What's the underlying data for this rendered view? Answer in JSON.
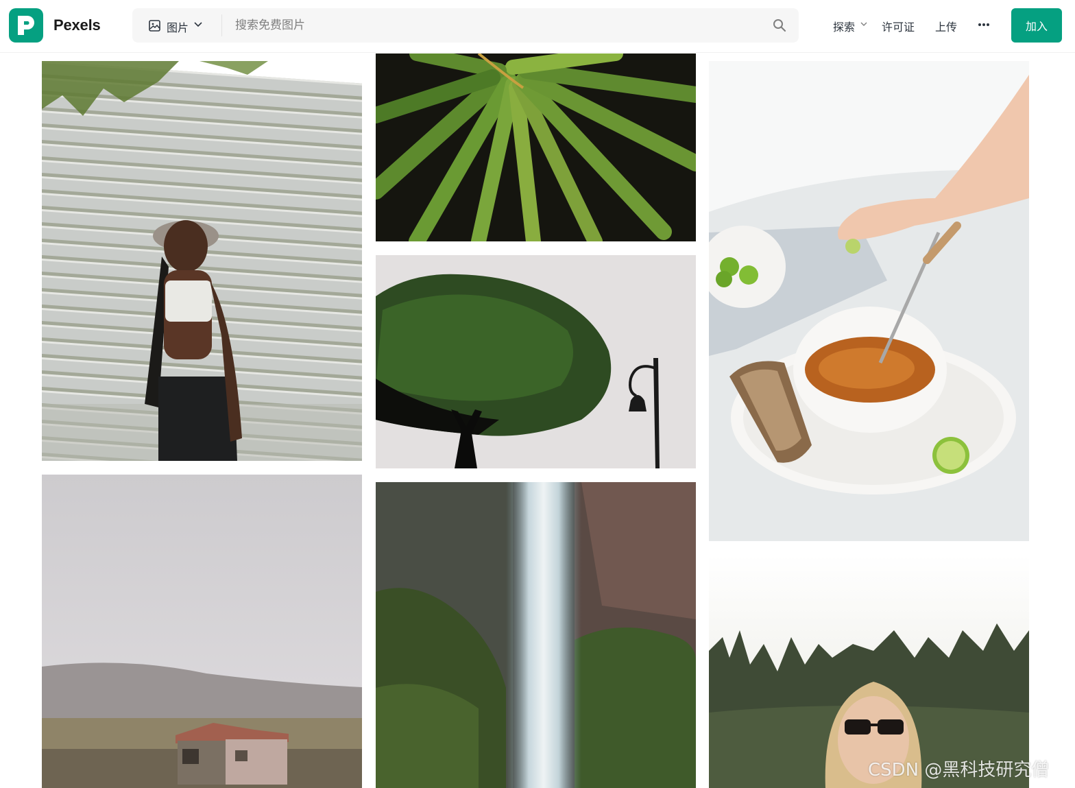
{
  "brand": {
    "name": "Pexels",
    "color": "#05a081"
  },
  "search": {
    "media_type": "图片",
    "placeholder": "搜索免费图片"
  },
  "nav": {
    "explore": "探索",
    "license": "许可证",
    "upload": "上传",
    "join": "加入"
  },
  "photos": [
    {
      "subject": "woman-bucket-hat"
    },
    {
      "subject": "palm-leaves"
    },
    {
      "subject": "tree-and-bell"
    },
    {
      "subject": "soup-bowl"
    },
    {
      "subject": "old-cabin"
    },
    {
      "subject": "waterfall"
    },
    {
      "subject": "woman-sunglasses"
    }
  ],
  "watermark": "CSDN @黑科技研究僧"
}
